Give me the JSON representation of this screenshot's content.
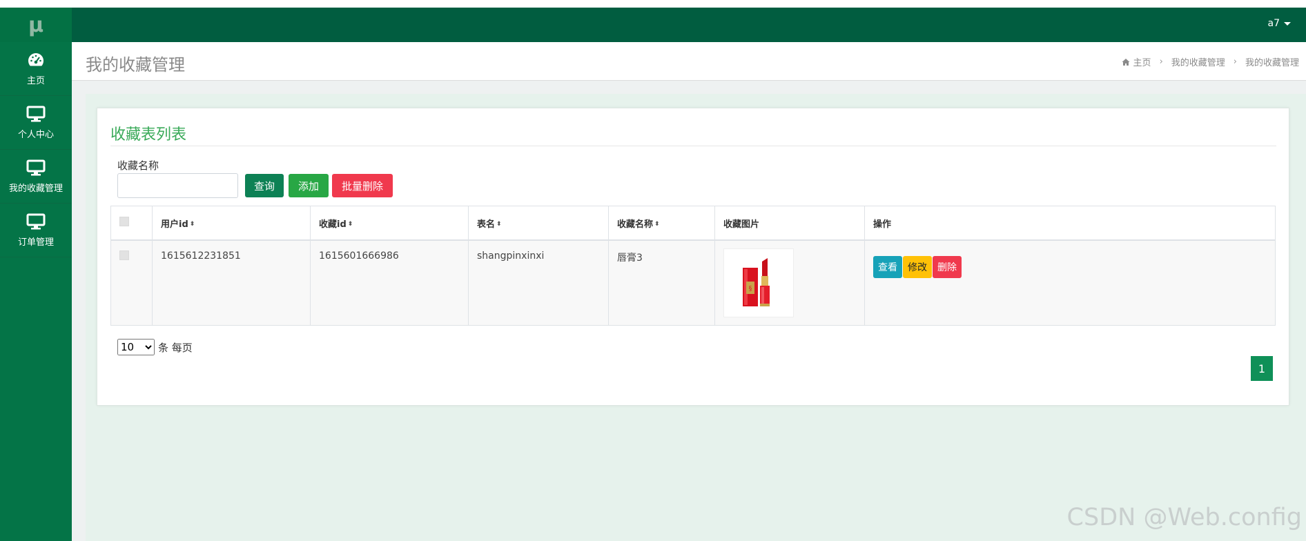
{
  "app": {
    "logo_text": "μ",
    "user": "a7"
  },
  "sidebar": {
    "items": [
      {
        "label": "主页",
        "icon": "dashboard-icon"
      },
      {
        "label": "个人中心",
        "icon": "monitor-icon"
      },
      {
        "label": "我的收藏管理",
        "icon": "monitor-icon"
      },
      {
        "label": "订单管理",
        "icon": "monitor-icon"
      }
    ]
  },
  "page": {
    "title": "我的收藏管理",
    "breadcrumb": [
      "主页",
      "我的收藏管理",
      "我的收藏管理"
    ]
  },
  "card": {
    "title": "收藏表列表",
    "filter_label": "收藏名称",
    "filter_value": "",
    "buttons": {
      "query": "查询",
      "add": "添加",
      "batch_delete": "批量删除"
    }
  },
  "table": {
    "columns": [
      "用户id",
      "收藏id",
      "表名",
      "收藏名称",
      "收藏图片",
      "操作"
    ],
    "rows": [
      {
        "user_id": "1615612231851",
        "fav_id": "1615601666986",
        "table_name": "shangpinxinxi",
        "fav_name": "唇膏3",
        "image": "lipstick-image",
        "actions": {
          "view": "查看",
          "edit": "修改",
          "delete": "删除"
        }
      }
    ]
  },
  "pagination": {
    "per_page": "10",
    "per_page_suffix": "条 每页",
    "current": "1"
  },
  "watermark": "CSDN @Web.config",
  "colors": {
    "sidebar": "#047447",
    "topbar": "#015d40",
    "accent": "#3aaa59",
    "query": "#0d8155",
    "add": "#28a745",
    "danger": "#f0394d",
    "view": "#17a2b8",
    "edit": "#ffc107"
  }
}
